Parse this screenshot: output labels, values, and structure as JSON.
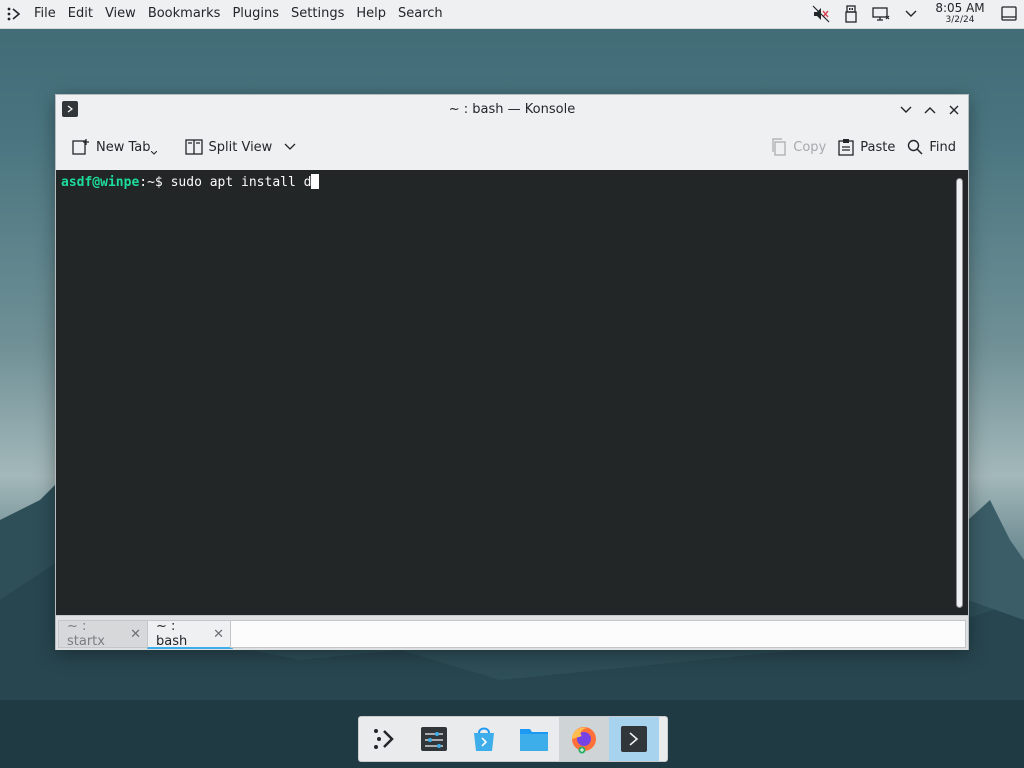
{
  "panel": {
    "menu": [
      "File",
      "Edit",
      "View",
      "Bookmarks",
      "Plugins",
      "Settings",
      "Help",
      "Search"
    ],
    "clock_time": "8:05 AM",
    "clock_date": "3/2/24"
  },
  "window": {
    "title": "~ : bash — Konsole",
    "toolbar": {
      "new_tab": "New Tab",
      "split_view": "Split View",
      "copy": "Copy",
      "paste": "Paste",
      "find": "Find"
    },
    "terminal": {
      "user_host": "asdf@winpe",
      "path": ":~$",
      "command": " sudo apt install d"
    },
    "tabs": [
      {
        "label": "~ : startx"
      },
      {
        "label": "~ : bash"
      }
    ]
  },
  "colors": {
    "accent": "#3daee9",
    "prompt_user": "#1cdc9a",
    "terminal_bg": "#232627"
  },
  "dock": {
    "items": [
      "application-launcher-icon",
      "system-settings-icon",
      "discover-store-icon",
      "file-manager-icon",
      "firefox-icon",
      "konsole-icon"
    ]
  }
}
